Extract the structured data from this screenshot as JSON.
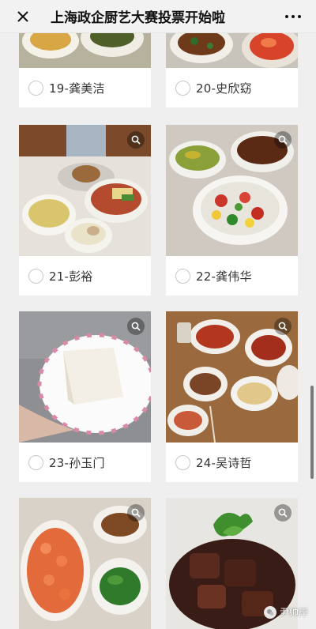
{
  "header": {
    "title": "上海政企厨艺大赛投票开始啦",
    "close_icon": "close-icon",
    "more_icon": "more-icon"
  },
  "candidates": [
    {
      "label": "19-龚美洁",
      "photo": "dish-photo"
    },
    {
      "label": "20-史欣窈",
      "photo": "dish-photo"
    },
    {
      "label": "21-彭裕",
      "photo": "dish-photo"
    },
    {
      "label": "22-龚伟华",
      "photo": "dish-photo"
    },
    {
      "label": "23-孙玉门",
      "photo": "dish-photo"
    },
    {
      "label": "24-吴诗哲",
      "photo": "dish-photo"
    },
    {
      "label": "",
      "photo": "dish-photo"
    },
    {
      "label": "",
      "photo": "dish-photo"
    }
  ],
  "watermark": {
    "text": "尹帅岸"
  }
}
